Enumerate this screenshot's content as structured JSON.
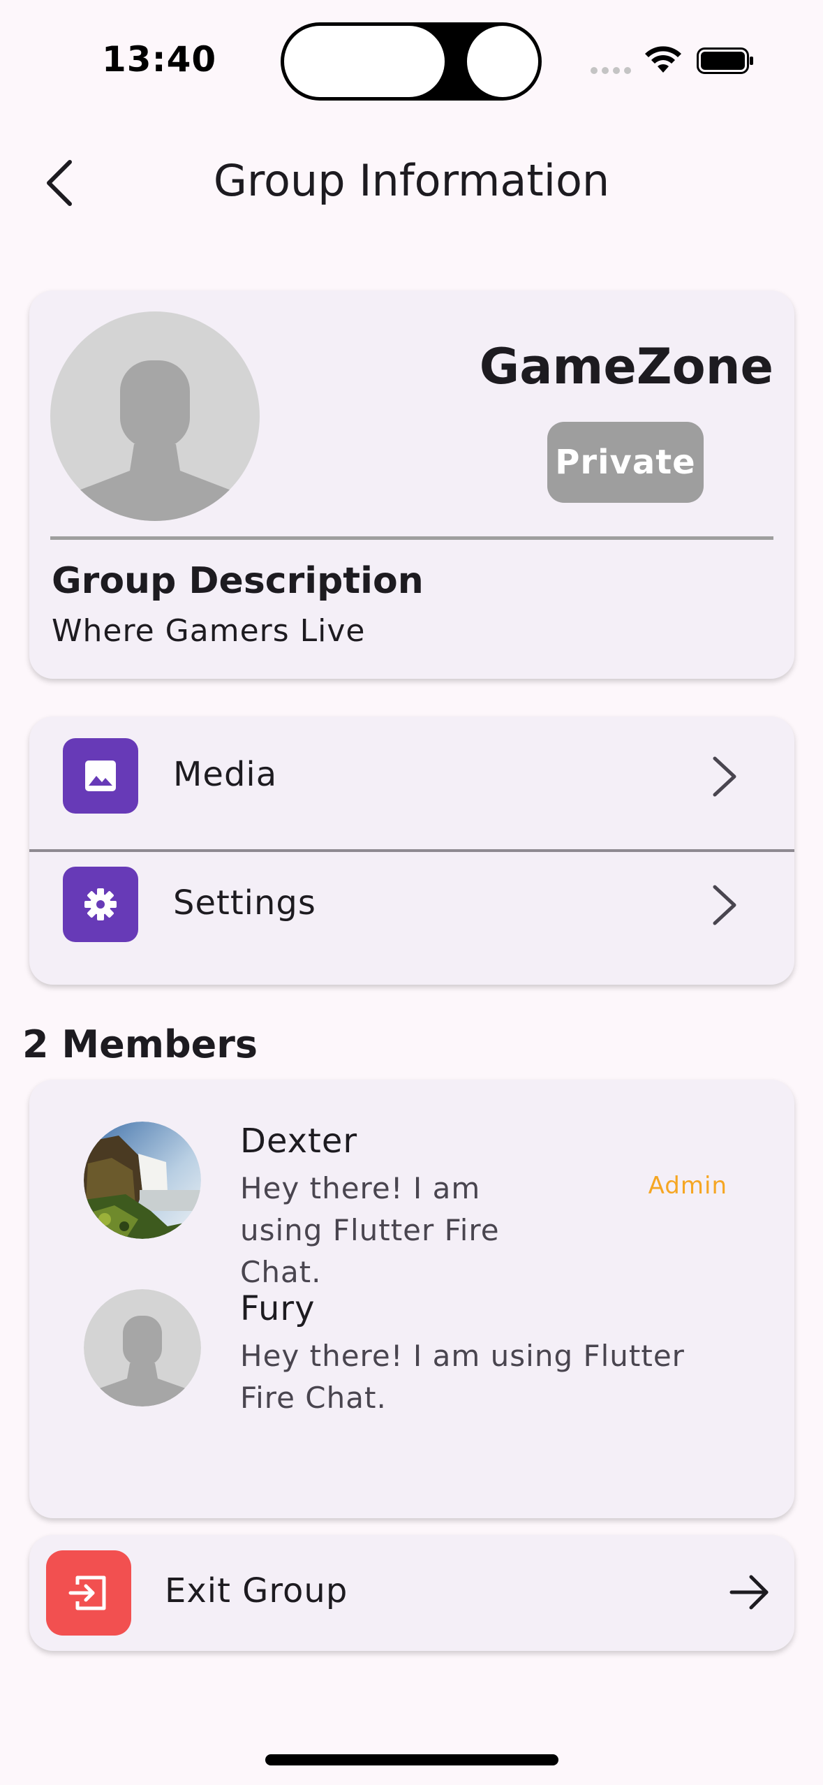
{
  "status_bar": {
    "time": "13:40"
  },
  "header": {
    "title": "Group Information",
    "back_icon": "chevron-left-icon"
  },
  "group": {
    "name": "GameZone",
    "privacy": "Private",
    "description_heading": "Group Description",
    "description": "Where Gamers Live",
    "avatar_icon": "person-placeholder-icon"
  },
  "menu": {
    "items": [
      {
        "label": "Media",
        "icon": "image-icon"
      },
      {
        "label": "Settings",
        "icon": "gear-icon"
      }
    ]
  },
  "members": {
    "heading": "2 Members",
    "list": [
      {
        "name": "Dexter",
        "status": "Hey there! I am using Flutter Fire Chat.",
        "role": "Admin",
        "avatar": "waterfall-photo"
      },
      {
        "name": "Fury",
        "status": "Hey there! I am using Flutter Fire Chat.",
        "role": "",
        "avatar": "person-placeholder-icon"
      }
    ]
  },
  "exit": {
    "label": "Exit Group",
    "icon": "exit-icon"
  },
  "colors": {
    "background": "#fdf7fb",
    "card": "#f4eff7",
    "accent_purple": "#673ab7",
    "exit_red": "#f25050",
    "admin_orange": "#f5a623",
    "badge_gray": "#9e9e9e"
  }
}
